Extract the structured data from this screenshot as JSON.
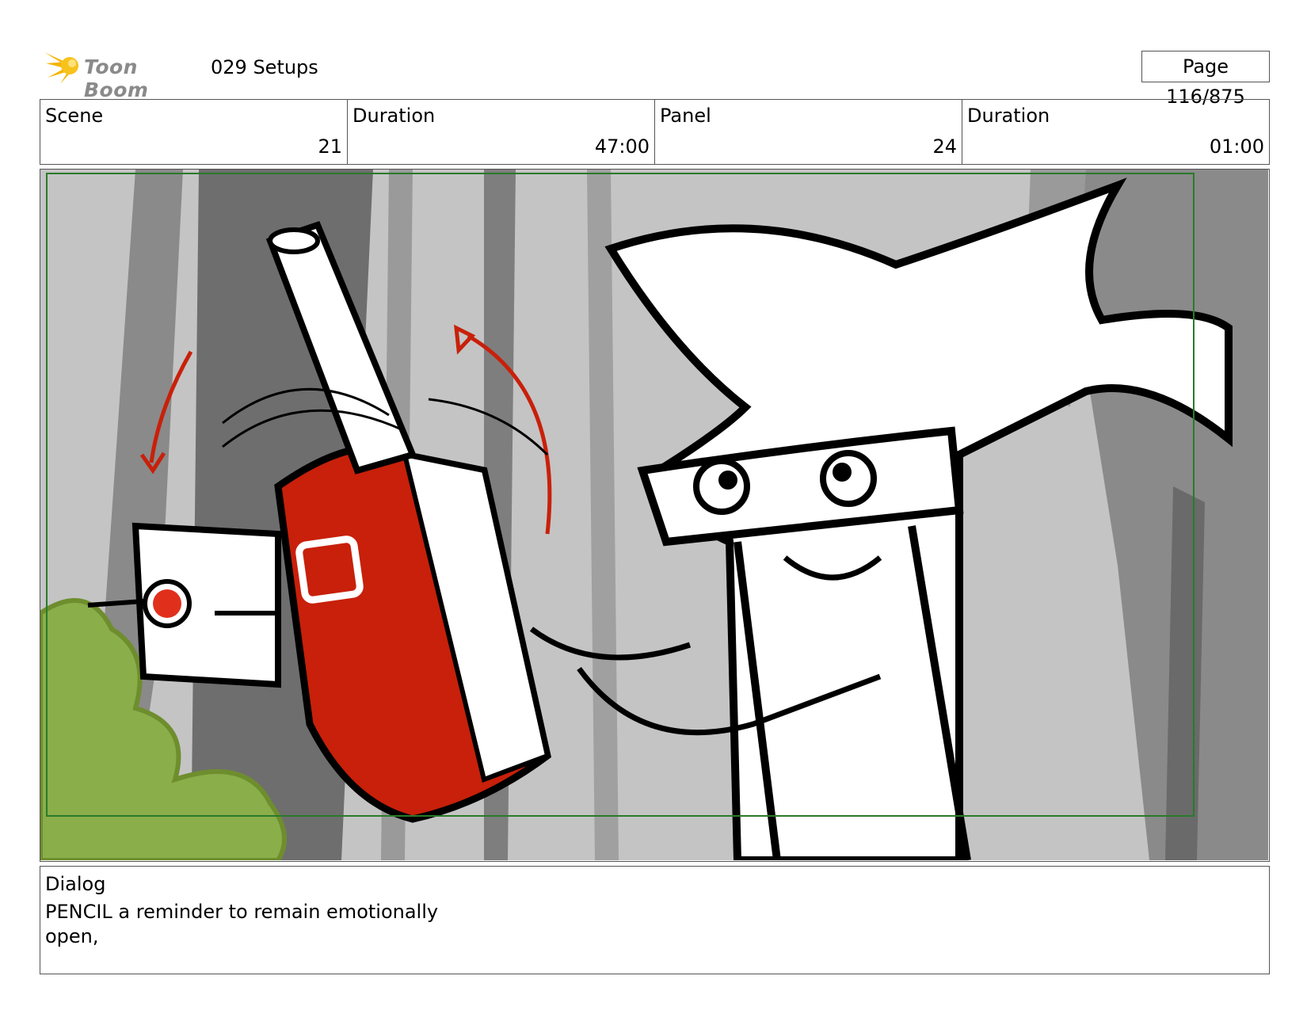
{
  "header": {
    "logo_text": "Toon Boom",
    "title": "029 Setups",
    "page": "Page 116/875"
  },
  "info": {
    "scene_label": "Scene",
    "scene_value": "21",
    "scene_duration_label": "Duration",
    "scene_duration_value": "47:00",
    "panel_label": "Panel",
    "panel_value": "24",
    "panel_duration_label": "Duration",
    "panel_duration_value": "01:00"
  },
  "dialog": {
    "label": "Dialog",
    "text": "PENCIL  a reminder to remain emotionally open,"
  },
  "colors": {
    "sketch_red": "#c8200a",
    "safe_area_green": "#2a7a2a",
    "bush_green": "#8aae4a"
  }
}
